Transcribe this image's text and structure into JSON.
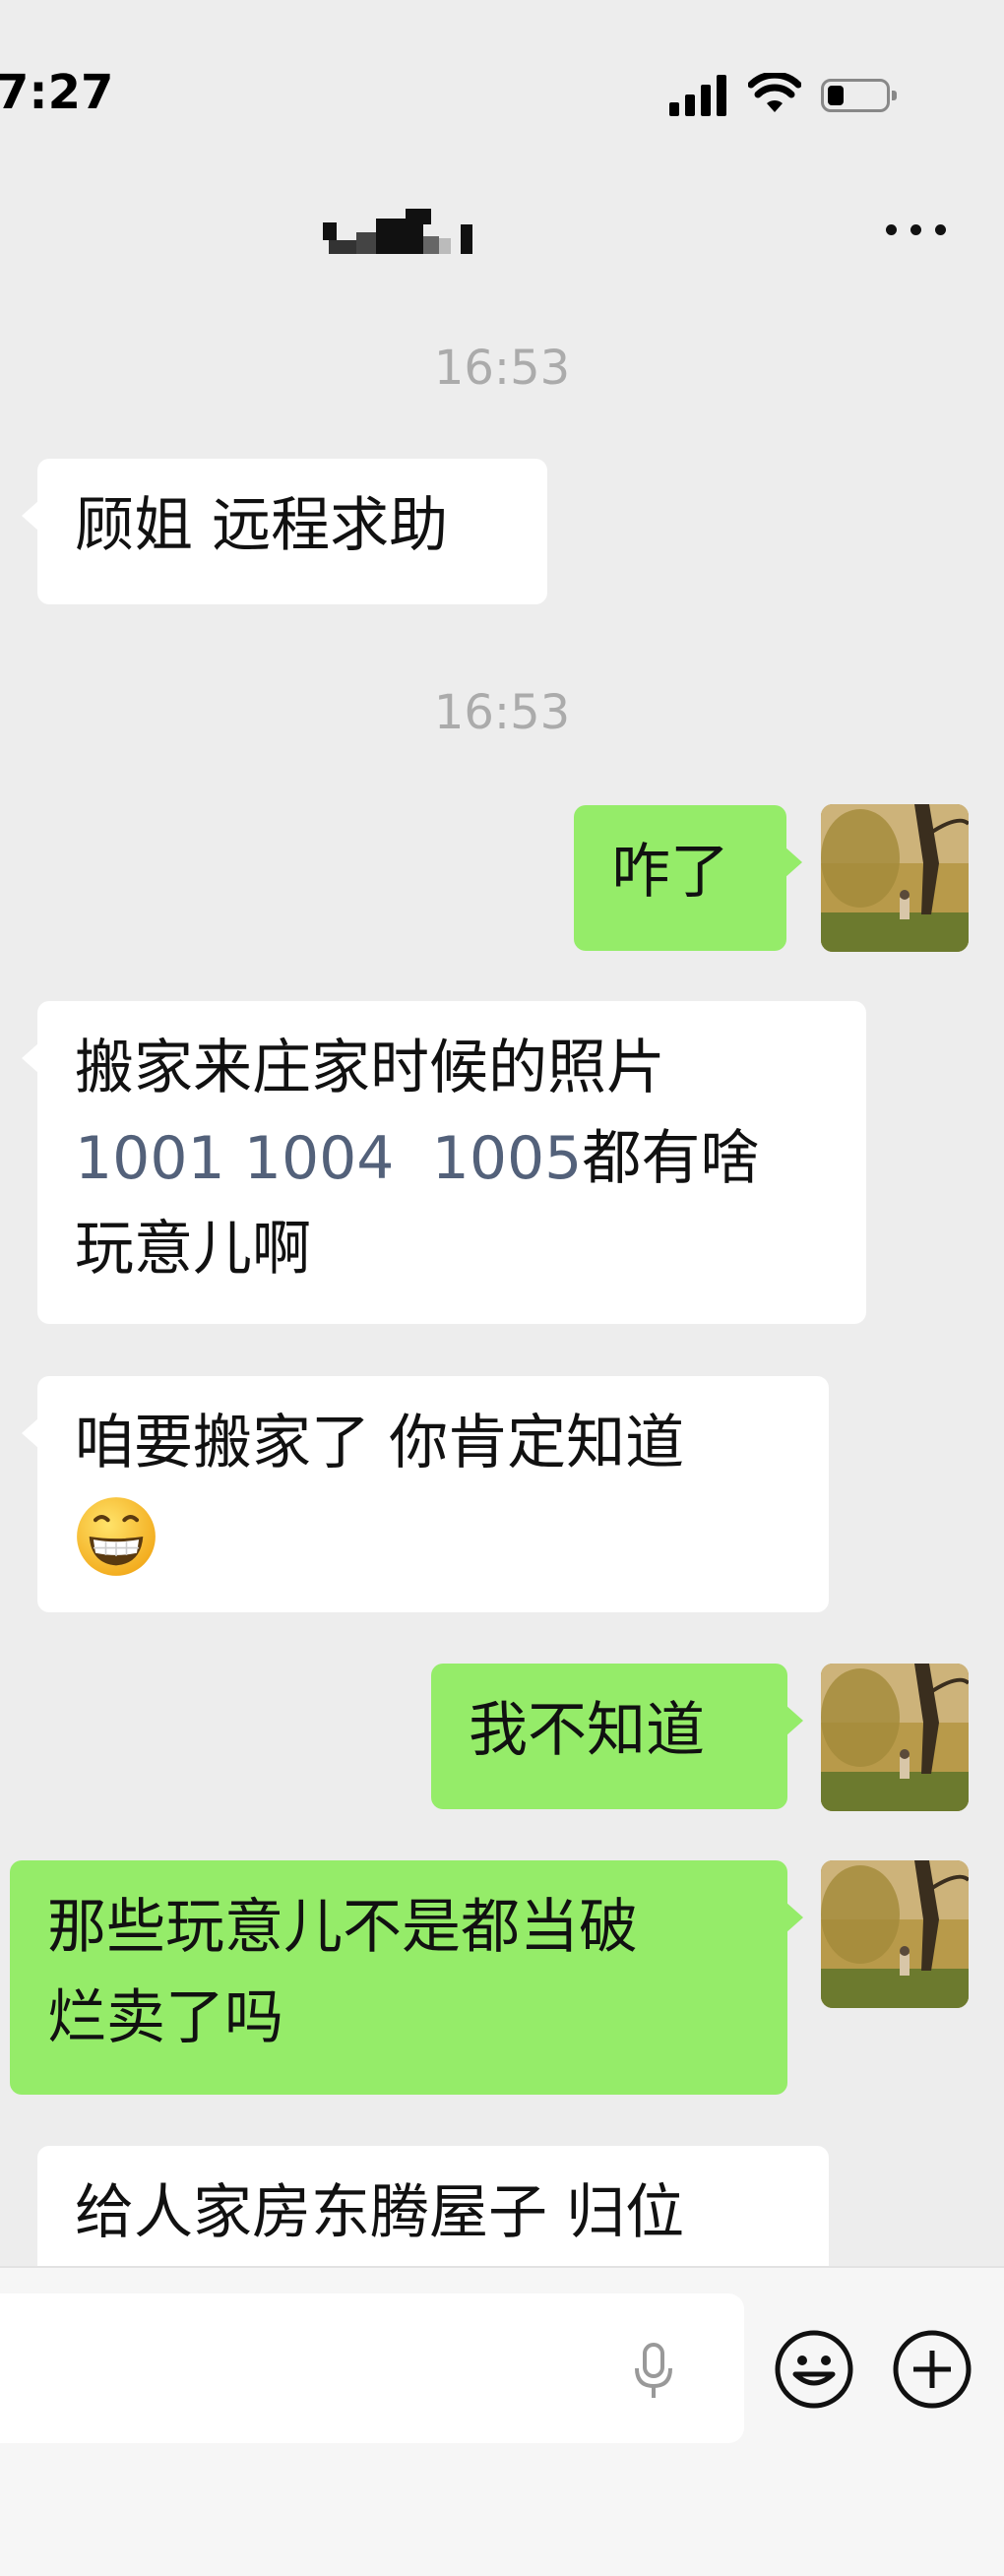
{
  "status_bar": {
    "time": "7:27"
  },
  "header": {
    "title_obscured": true
  },
  "messages": [
    {
      "type": "timestamp",
      "text": "16:53"
    },
    {
      "type": "incoming",
      "text": "顾姐 远程求助"
    },
    {
      "type": "timestamp",
      "text": "16:53"
    },
    {
      "type": "outgoing",
      "text": "咋了"
    },
    {
      "type": "incoming",
      "lines": [
        "搬家来庄家时候的照片",
        "1001 1004  1005都有啥",
        "玩意儿啊"
      ],
      "link_numbers": [
        "1001",
        "1004",
        "1005"
      ],
      "line2_suffix": "都有啥"
    },
    {
      "type": "incoming",
      "lines": [
        "咱要搬家了 你肯定知道"
      ],
      "emoji": "grinning-face"
    },
    {
      "type": "outgoing",
      "text": "我不知道"
    },
    {
      "type": "outgoing",
      "lines": [
        "那些玩意儿不是都当破",
        "烂卖了吗"
      ]
    },
    {
      "type": "incoming",
      "lines": [
        "给人家房东腾屋子 归位"
      ]
    }
  ],
  "colors": {
    "background": "#ededed",
    "outgoing_bubble": "#95ec69",
    "incoming_bubble": "#ffffff",
    "timestamp": "#ababab",
    "link_number": "#53617a"
  },
  "icons": {
    "more": "more-icon",
    "mic": "microphone-icon",
    "emoji": "emoji-icon",
    "plus": "plus-icon"
  }
}
